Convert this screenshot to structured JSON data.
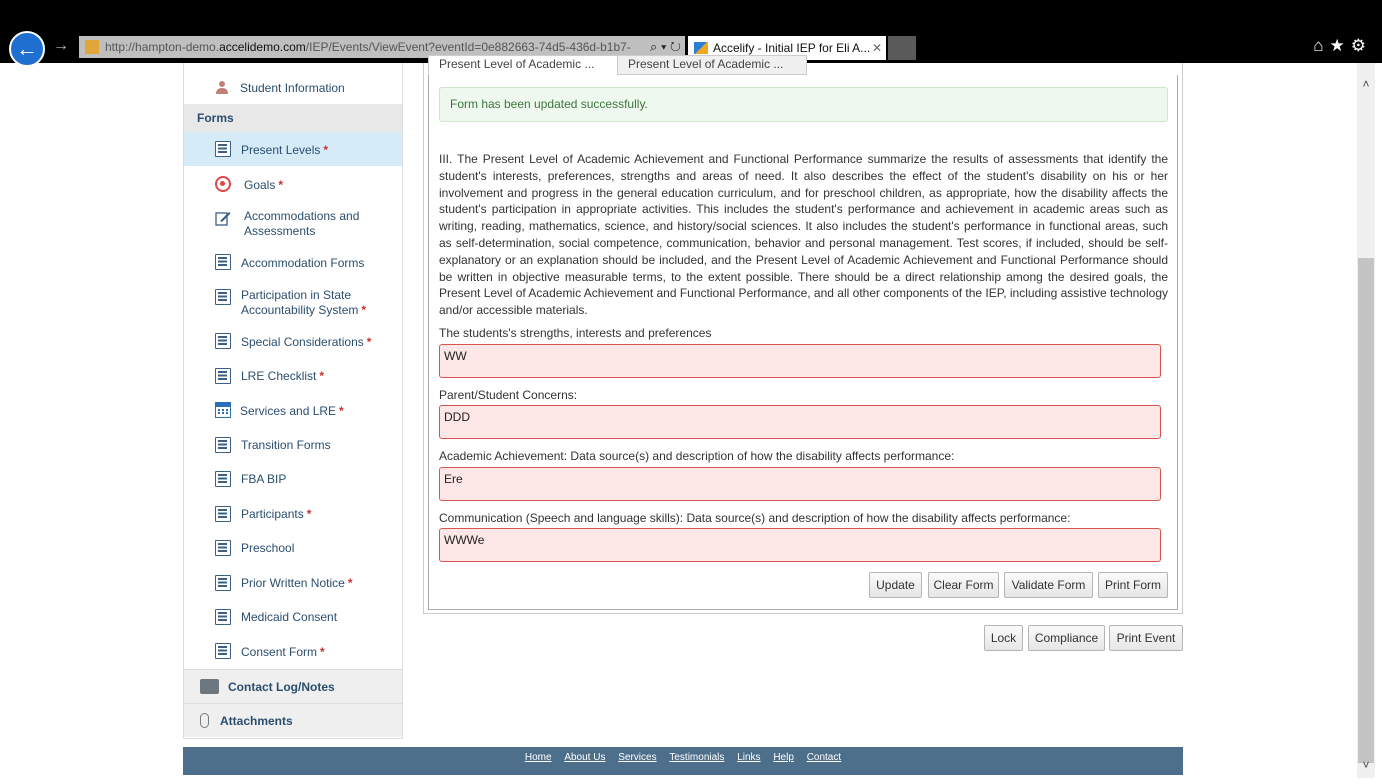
{
  "browser": {
    "url_prefix": "http://hampton-demo.",
    "url_domain": "accelidemo.com",
    "url_suffix": "/IEP/Events/ViewEvent?eventId=0e882663-74d5-436d-b1b7-",
    "tab_title": "Accelify - Initial IEP for Eli A...",
    "icons": [
      "back-icon",
      "forward-icon",
      "search-icon",
      "refresh-icon",
      "home-icon",
      "star-icon",
      "gear-icon"
    ]
  },
  "sidebar": {
    "student_info": "Student Information",
    "forms_header": "Forms",
    "items": [
      {
        "label": "Present Levels",
        "required": "*",
        "icon": "list-icon"
      },
      {
        "label": "Goals",
        "required": "*",
        "icon": "target-icon"
      },
      {
        "label": "Accommodations and Assessments",
        "required": "",
        "icon": "edit-icon"
      },
      {
        "label": "Accommodation Forms",
        "required": "",
        "icon": "list-icon"
      },
      {
        "label": "Participation in State Accountability System",
        "required": "*",
        "icon": "list-icon"
      },
      {
        "label": "Special Considerations",
        "required": "*",
        "icon": "list-icon"
      },
      {
        "label": "LRE Checklist",
        "required": "*",
        "icon": "list-icon"
      },
      {
        "label": "Services and LRE",
        "required": "*",
        "icon": "calendar-icon"
      },
      {
        "label": "Transition Forms",
        "required": "",
        "icon": "list-icon"
      },
      {
        "label": "FBA BIP",
        "required": "",
        "icon": "list-icon"
      },
      {
        "label": "Participants",
        "required": "*",
        "icon": "list-icon"
      },
      {
        "label": "Preschool",
        "required": "",
        "icon": "list-icon"
      },
      {
        "label": "Prior Written Notice",
        "required": "*",
        "icon": "list-icon"
      },
      {
        "label": "Medicaid Consent",
        "required": "",
        "icon": "list-icon"
      },
      {
        "label": "Consent Form",
        "required": "*",
        "icon": "list-icon"
      }
    ],
    "contact_log": "Contact Log/Notes",
    "attachments": "Attachments"
  },
  "tabs": [
    "Present Level of Academic ...",
    "Present Level of Academic ..."
  ],
  "success_message": "Form has been updated successfully.",
  "instructions": "III. The Present Level of Academic Achievement and Functional Performance summarize the results of assessments that identify the student's interests, preferences, strengths and areas of need. It also describes the effect of the student's disability on his or her involvement and progress in the general education curriculum, and for preschool children, as appropriate, how the disability affects the student's participation in appropriate activities. This includes the student's performance and achievement in academic areas such as writing, reading, mathematics, science, and history/social sciences. It also includes the student's performance in functional areas, such as self-determination, social competence, communication, behavior and personal management. Test scores, if included, should be self-explanatory or an explanation should be included, and the Present Level of Academic Achievement and Functional Performance should be written in objective measurable terms, to the extent possible. There should be a direct relationship among the desired goals, the Present Level of Academic Achievement and Functional Performance, and all other components of the IEP, including assistive technology and/or accessible materials.",
  "fields": [
    {
      "label": "The students's strengths, interests and preferences",
      "value": "WW"
    },
    {
      "label": "Parent/Student Concerns:",
      "value": "DDD"
    },
    {
      "label": "Academic Achievement: Data source(s) and description of how the disability affects performance:",
      "value": "Ere"
    },
    {
      "label": "Communication (Speech and language skills): Data source(s) and description of how the disability affects performance:",
      "value": "WWWe"
    }
  ],
  "form_buttons": {
    "update": "Update",
    "clear": "Clear Form",
    "validate": "Validate Form",
    "print": "Print Form"
  },
  "event_buttons": {
    "lock": "Lock",
    "compliance": "Compliance",
    "print_event": "Print Event"
  },
  "footer_links": [
    "Home",
    "About Us",
    "Services",
    "Testimonials",
    "Links",
    "Help",
    "Contact"
  ]
}
